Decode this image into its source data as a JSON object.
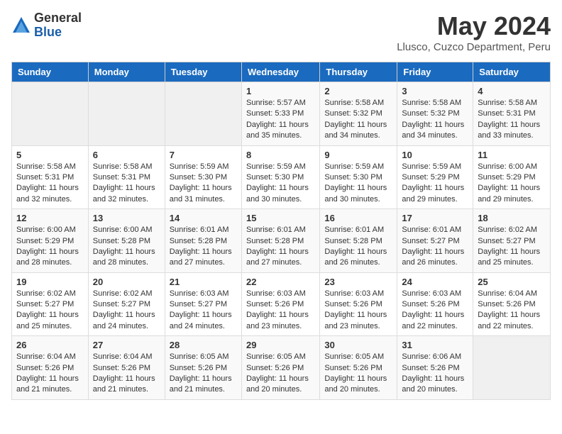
{
  "logo": {
    "general": "General",
    "blue": "Blue"
  },
  "title": {
    "month": "May 2024",
    "location": "Llusco, Cuzco Department, Peru"
  },
  "headers": [
    "Sunday",
    "Monday",
    "Tuesday",
    "Wednesday",
    "Thursday",
    "Friday",
    "Saturday"
  ],
  "weeks": [
    [
      {
        "day": "",
        "info": ""
      },
      {
        "day": "",
        "info": ""
      },
      {
        "day": "",
        "info": ""
      },
      {
        "day": "1",
        "info": "Sunrise: 5:57 AM\nSunset: 5:33 PM\nDaylight: 11 hours and 35 minutes."
      },
      {
        "day": "2",
        "info": "Sunrise: 5:58 AM\nSunset: 5:32 PM\nDaylight: 11 hours and 34 minutes."
      },
      {
        "day": "3",
        "info": "Sunrise: 5:58 AM\nSunset: 5:32 PM\nDaylight: 11 hours and 34 minutes."
      },
      {
        "day": "4",
        "info": "Sunrise: 5:58 AM\nSunset: 5:31 PM\nDaylight: 11 hours and 33 minutes."
      }
    ],
    [
      {
        "day": "5",
        "info": "Sunrise: 5:58 AM\nSunset: 5:31 PM\nDaylight: 11 hours and 32 minutes."
      },
      {
        "day": "6",
        "info": "Sunrise: 5:58 AM\nSunset: 5:31 PM\nDaylight: 11 hours and 32 minutes."
      },
      {
        "day": "7",
        "info": "Sunrise: 5:59 AM\nSunset: 5:30 PM\nDaylight: 11 hours and 31 minutes."
      },
      {
        "day": "8",
        "info": "Sunrise: 5:59 AM\nSunset: 5:30 PM\nDaylight: 11 hours and 30 minutes."
      },
      {
        "day": "9",
        "info": "Sunrise: 5:59 AM\nSunset: 5:30 PM\nDaylight: 11 hours and 30 minutes."
      },
      {
        "day": "10",
        "info": "Sunrise: 5:59 AM\nSunset: 5:29 PM\nDaylight: 11 hours and 29 minutes."
      },
      {
        "day": "11",
        "info": "Sunrise: 6:00 AM\nSunset: 5:29 PM\nDaylight: 11 hours and 29 minutes."
      }
    ],
    [
      {
        "day": "12",
        "info": "Sunrise: 6:00 AM\nSunset: 5:29 PM\nDaylight: 11 hours and 28 minutes."
      },
      {
        "day": "13",
        "info": "Sunrise: 6:00 AM\nSunset: 5:28 PM\nDaylight: 11 hours and 28 minutes."
      },
      {
        "day": "14",
        "info": "Sunrise: 6:01 AM\nSunset: 5:28 PM\nDaylight: 11 hours and 27 minutes."
      },
      {
        "day": "15",
        "info": "Sunrise: 6:01 AM\nSunset: 5:28 PM\nDaylight: 11 hours and 27 minutes."
      },
      {
        "day": "16",
        "info": "Sunrise: 6:01 AM\nSunset: 5:28 PM\nDaylight: 11 hours and 26 minutes."
      },
      {
        "day": "17",
        "info": "Sunrise: 6:01 AM\nSunset: 5:27 PM\nDaylight: 11 hours and 26 minutes."
      },
      {
        "day": "18",
        "info": "Sunrise: 6:02 AM\nSunset: 5:27 PM\nDaylight: 11 hours and 25 minutes."
      }
    ],
    [
      {
        "day": "19",
        "info": "Sunrise: 6:02 AM\nSunset: 5:27 PM\nDaylight: 11 hours and 25 minutes."
      },
      {
        "day": "20",
        "info": "Sunrise: 6:02 AM\nSunset: 5:27 PM\nDaylight: 11 hours and 24 minutes."
      },
      {
        "day": "21",
        "info": "Sunrise: 6:03 AM\nSunset: 5:27 PM\nDaylight: 11 hours and 24 minutes."
      },
      {
        "day": "22",
        "info": "Sunrise: 6:03 AM\nSunset: 5:26 PM\nDaylight: 11 hours and 23 minutes."
      },
      {
        "day": "23",
        "info": "Sunrise: 6:03 AM\nSunset: 5:26 PM\nDaylight: 11 hours and 23 minutes."
      },
      {
        "day": "24",
        "info": "Sunrise: 6:03 AM\nSunset: 5:26 PM\nDaylight: 11 hours and 22 minutes."
      },
      {
        "day": "25",
        "info": "Sunrise: 6:04 AM\nSunset: 5:26 PM\nDaylight: 11 hours and 22 minutes."
      }
    ],
    [
      {
        "day": "26",
        "info": "Sunrise: 6:04 AM\nSunset: 5:26 PM\nDaylight: 11 hours and 21 minutes."
      },
      {
        "day": "27",
        "info": "Sunrise: 6:04 AM\nSunset: 5:26 PM\nDaylight: 11 hours and 21 minutes."
      },
      {
        "day": "28",
        "info": "Sunrise: 6:05 AM\nSunset: 5:26 PM\nDaylight: 11 hours and 21 minutes."
      },
      {
        "day": "29",
        "info": "Sunrise: 6:05 AM\nSunset: 5:26 PM\nDaylight: 11 hours and 20 minutes."
      },
      {
        "day": "30",
        "info": "Sunrise: 6:05 AM\nSunset: 5:26 PM\nDaylight: 11 hours and 20 minutes."
      },
      {
        "day": "31",
        "info": "Sunrise: 6:06 AM\nSunset: 5:26 PM\nDaylight: 11 hours and 20 minutes."
      },
      {
        "day": "",
        "info": ""
      }
    ]
  ]
}
